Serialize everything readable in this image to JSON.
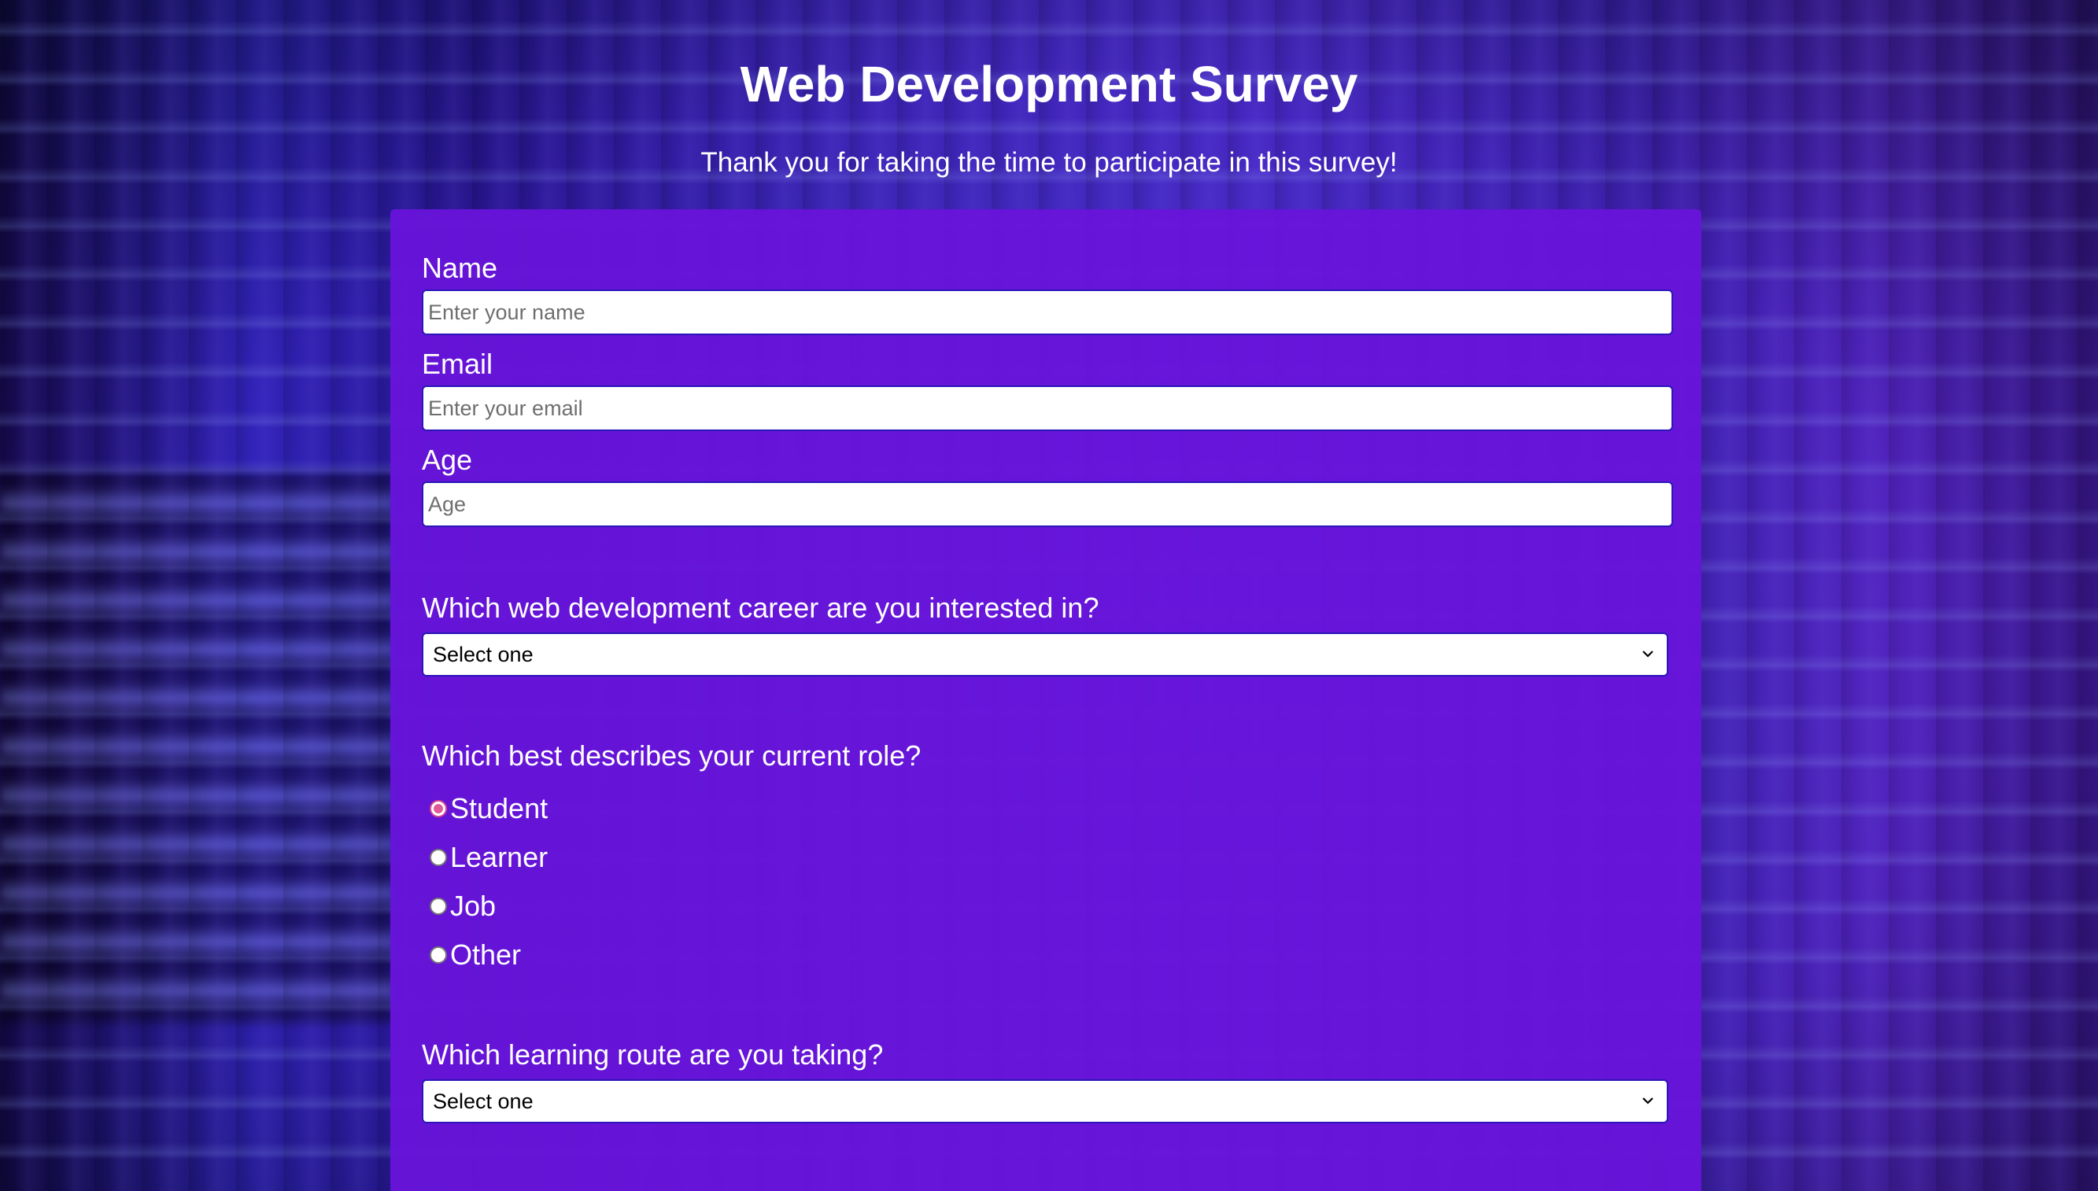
{
  "header": {
    "title": "Web Development Survey",
    "description": "Thank you for taking the time to participate in this survey!"
  },
  "form": {
    "name": {
      "label": "Name",
      "placeholder": "Enter your name",
      "value": ""
    },
    "email": {
      "label": "Email",
      "placeholder": "Enter your email",
      "value": ""
    },
    "age": {
      "label": "Age",
      "placeholder": "Age",
      "value": ""
    },
    "career": {
      "label": "Which web development career are you interested in?",
      "selected": "Select one"
    },
    "role": {
      "label": "Which best describes your current role?",
      "options": [
        {
          "label": "Student",
          "checked": true
        },
        {
          "label": "Learner",
          "checked": false
        },
        {
          "label": "Job",
          "checked": false
        },
        {
          "label": "Other",
          "checked": false
        }
      ]
    },
    "route": {
      "label": "Which learning route are you taking?",
      "selected": "Select one"
    }
  },
  "colors": {
    "card_background": "#6814da",
    "input_border": "#2a16b8",
    "radio_checked": "#e05a9a"
  }
}
